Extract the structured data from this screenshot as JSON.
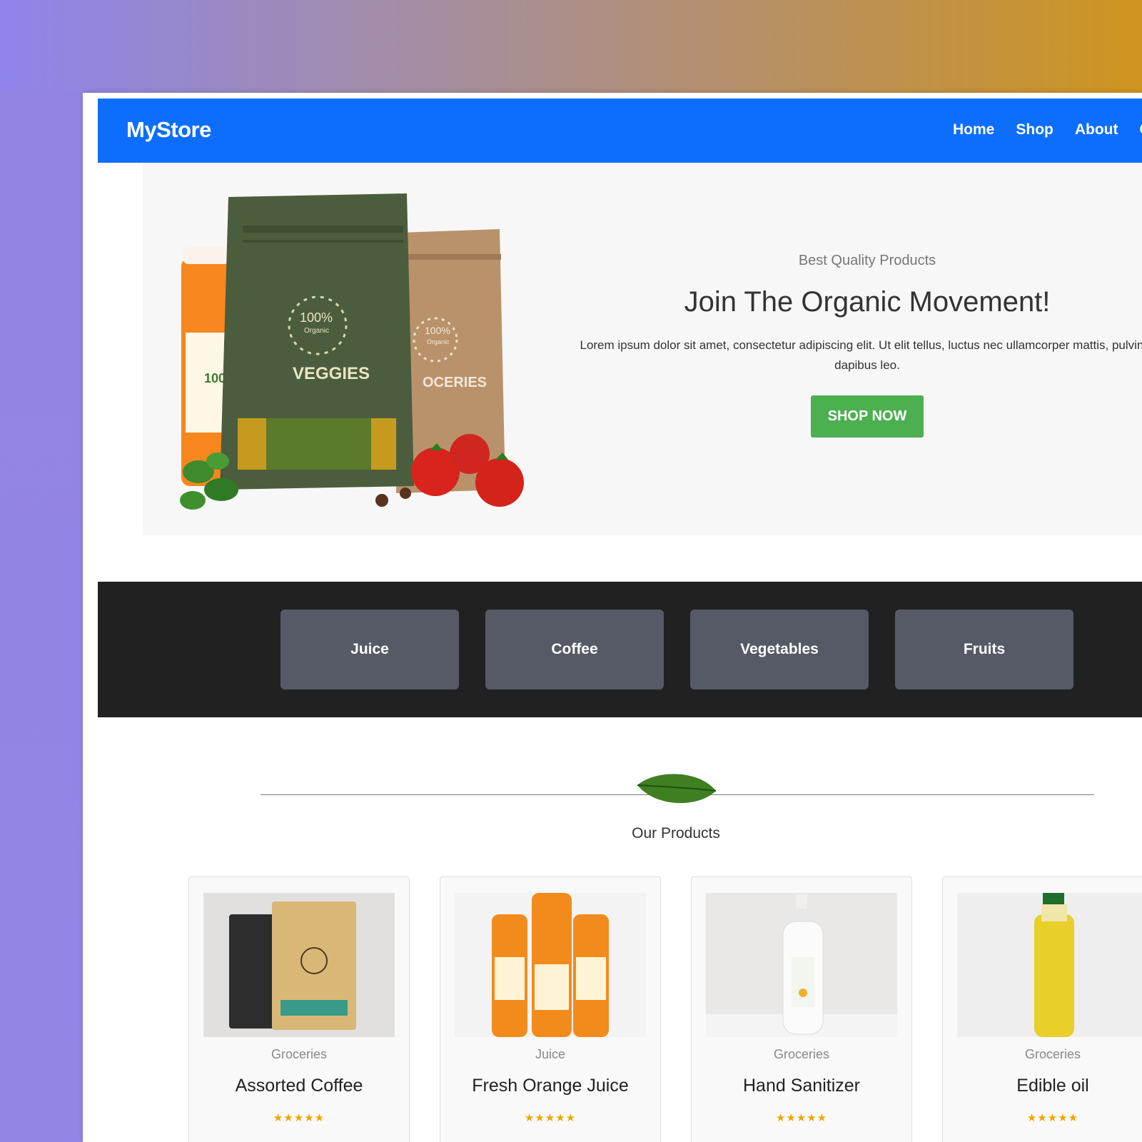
{
  "nav": {
    "brand": "MyStore",
    "links": [
      "Home",
      "Shop",
      "About",
      "Co"
    ]
  },
  "hero": {
    "kicker": "Best Quality Products",
    "title": "Join The Organic Movement!",
    "description": "Lorem ipsum dolor sit amet, consectetur adipiscing elit. Ut elit tellus, luctus nec ullamcorper mattis, pulvinar dapibus leo.",
    "button": "SHOP NOW",
    "image_labels": {
      "bag1_badge": "100%",
      "bag1_sub": "Organic",
      "bag1_name": "VEGGIES",
      "bag2_badge": "100%",
      "bag2_sub": "Organic",
      "bag2_name": "OCERIES",
      "jar_text": "100"
    }
  },
  "categories": [
    "Juice",
    "Coffee",
    "Vegetables",
    "Fruits"
  ],
  "products_section": {
    "title": "Our Products"
  },
  "products": [
    {
      "category": "Groceries",
      "name": "Assorted Coffee",
      "rating": 5,
      "stars": "★★★★★"
    },
    {
      "category": "Juice",
      "name": "Fresh Orange Juice",
      "rating": 5,
      "stars": "★★★★★"
    },
    {
      "category": "Groceries",
      "name": "Hand Sanitizer",
      "rating": 5,
      "stars": "★★★★★"
    },
    {
      "category": "Groceries",
      "name": "Edible oil",
      "rating": 5,
      "stars": "★★★★★"
    }
  ],
  "colors": {
    "nav_bg": "#0d6efd",
    "shop_button": "#4caf50",
    "category_band": "#212121",
    "category_button": "#555a66",
    "star": "#f0a500"
  }
}
